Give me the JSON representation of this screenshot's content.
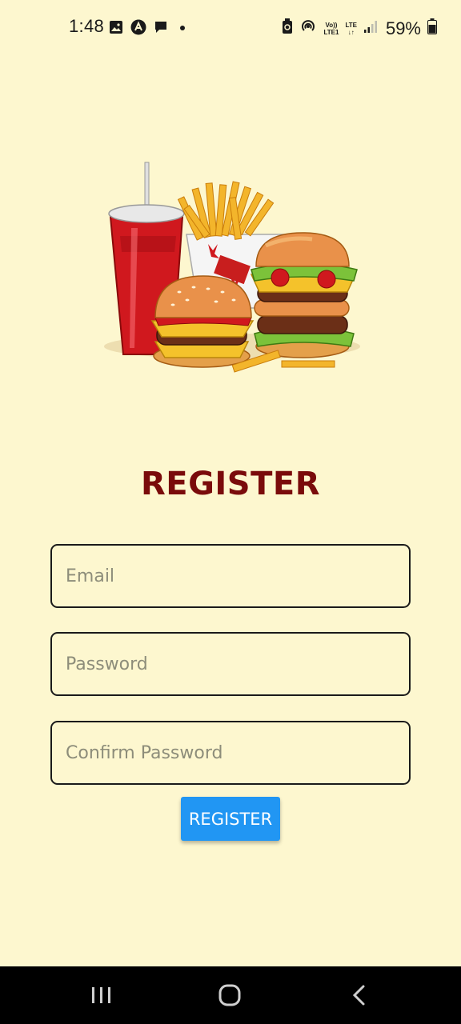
{
  "status_bar": {
    "time": "1:48",
    "battery_percent": "59%",
    "network_label_top": "Vo))",
    "network_label_bottom": "LTE1",
    "lte_label": "LTE",
    "lte_sub": "↓↑",
    "icons": [
      "image-icon",
      "app-icon",
      "chat-icon",
      "dot-icon",
      "saver-icon",
      "hotspot-icon",
      "signal-icon",
      "battery-icon"
    ]
  },
  "hero": {
    "icon": "fast-food-illustration"
  },
  "form": {
    "title": "REGISTER",
    "email_placeholder": "Email",
    "password_placeholder": "Password",
    "confirm_placeholder": "Confirm Password",
    "submit_label": "REGISTER"
  },
  "colors": {
    "background": "#fdf7cf",
    "title": "#7a0b0b",
    "button": "#2196f3"
  },
  "nav_bar": {
    "icons": [
      "recents-icon",
      "home-icon",
      "back-icon"
    ]
  }
}
